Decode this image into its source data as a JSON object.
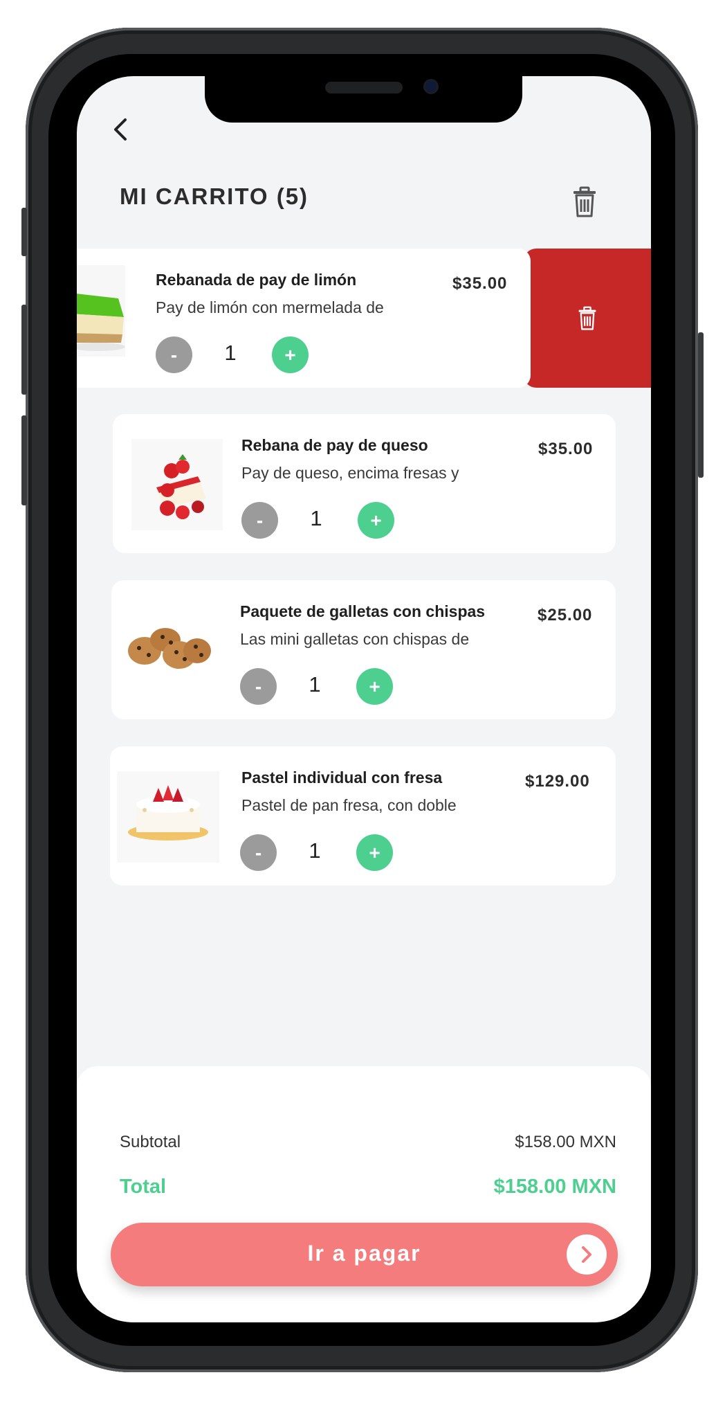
{
  "header": {
    "title": "MI CARRITO (5)"
  },
  "cart": {
    "items": [
      {
        "name": "Rebanada de pay de limón",
        "desc": "Pay de limón con mermelada de",
        "price": "$35.00",
        "qty": "1"
      },
      {
        "name": "Rebana de pay de queso",
        "desc": "Pay de queso, encima fresas y",
        "price": "$35.00",
        "qty": "1"
      },
      {
        "name": "Paquete de galletas con chispas",
        "desc": "Las mini galletas con chispas de",
        "price": "$25.00",
        "qty": "1"
      },
      {
        "name": "Pastel individual con fresa",
        "desc": "Pastel de pan fresa, con doble",
        "price": "$129.00",
        "qty": "1"
      }
    ],
    "minus_label": "-",
    "plus_label": "+"
  },
  "summary": {
    "subtotal_label": "Subtotal",
    "subtotal_value": "$158.00 MXN",
    "total_label": "Total",
    "total_value": "$158.00 MXN",
    "pay_label": "Ir a pagar"
  },
  "colors": {
    "accent_green": "#4ccf8f",
    "delete_red": "#c62828",
    "pay_button": "#f47c7c"
  },
  "icons": [
    "back-arrow-icon",
    "trash-icon",
    "chevron-right-icon"
  ]
}
